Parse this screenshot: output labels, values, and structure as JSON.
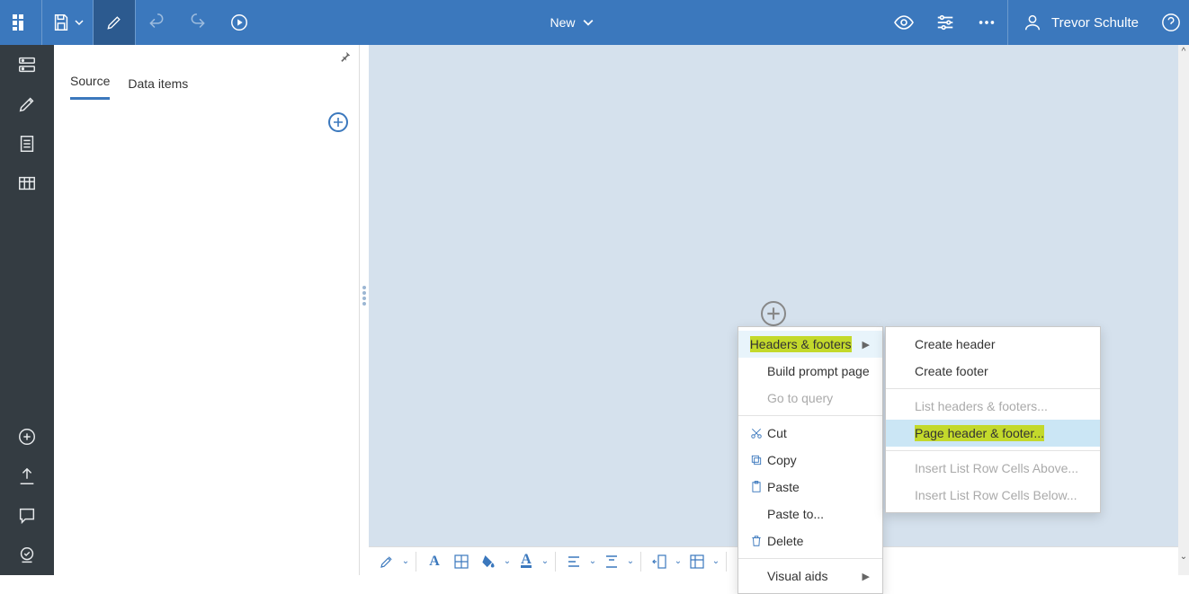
{
  "topbar": {
    "title": "New",
    "user_name": "Trevor Schulte"
  },
  "sidenav": {
    "tabs": {
      "source": "Source",
      "data_items": "Data items"
    }
  },
  "context_menu": {
    "headers_footers": "Headers & footers",
    "build_prompt_page": "Build prompt page",
    "go_to_query": "Go to query",
    "cut": "Cut",
    "copy": "Copy",
    "paste": "Paste",
    "paste_to": "Paste to...",
    "delete": "Delete",
    "visual_aids": "Visual aids"
  },
  "submenu": {
    "create_header": "Create header",
    "create_footer": "Create footer",
    "list_headers_footers": "List headers & footers...",
    "page_header_footer": "Page header & footer...",
    "insert_above": "Insert List Row Cells Above...",
    "insert_below": "Insert List Row Cells Below..."
  }
}
